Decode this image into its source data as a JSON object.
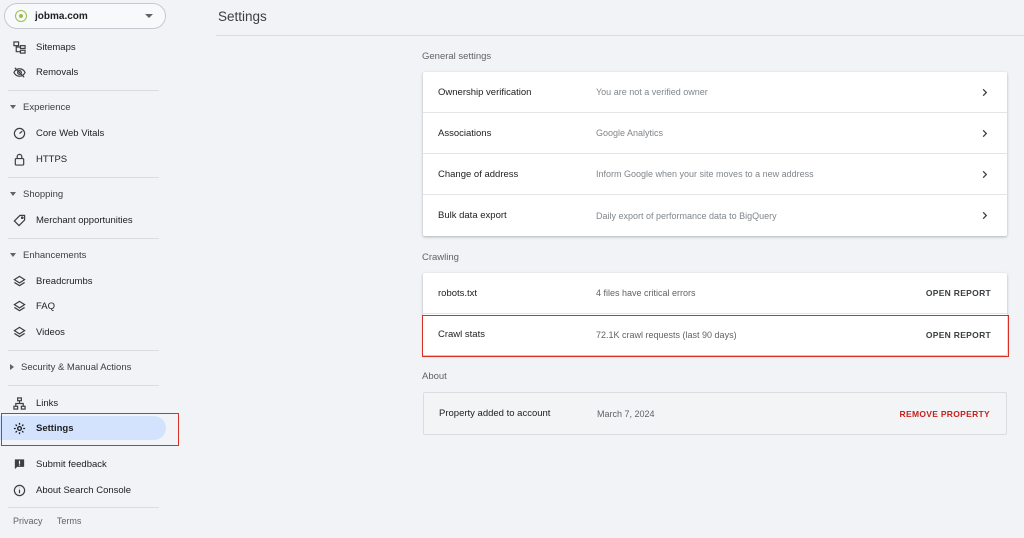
{
  "property": {
    "name": "jobma.com"
  },
  "sidebar": {
    "items_top": [
      {
        "label": "Sitemaps",
        "icon": "sitemap-icon"
      },
      {
        "label": "Removals",
        "icon": "eye-off-icon"
      }
    ],
    "experience": {
      "label": "Experience",
      "items": [
        {
          "label": "Core Web Vitals",
          "icon": "speed-icon"
        },
        {
          "label": "HTTPS",
          "icon": "lock-icon"
        }
      ]
    },
    "shopping": {
      "label": "Shopping",
      "items": [
        {
          "label": "Merchant opportunities",
          "icon": "tag-icon"
        }
      ]
    },
    "enhancements": {
      "label": "Enhancements",
      "items": [
        {
          "label": "Breadcrumbs",
          "icon": "layers-icon"
        },
        {
          "label": "FAQ",
          "icon": "layers-icon"
        },
        {
          "label": "Videos",
          "icon": "layers-icon"
        }
      ]
    },
    "security": {
      "label": "Security & Manual Actions"
    },
    "links": {
      "label": "Links",
      "icon": "links-icon"
    },
    "settings": {
      "label": "Settings",
      "icon": "gear-icon"
    },
    "feedback": {
      "label": "Submit feedback",
      "icon": "feedback-icon"
    },
    "about": {
      "label": "About Search Console",
      "icon": "info-icon"
    },
    "footer": {
      "privacy": "Privacy",
      "terms": "Terms"
    }
  },
  "header": {
    "title": "Settings"
  },
  "general": {
    "label": "General settings",
    "rows": [
      {
        "label": "Ownership verification",
        "desc": "You are not a verified owner"
      },
      {
        "label": "Associations",
        "desc": "Google Analytics"
      },
      {
        "label": "Change of address",
        "desc": "Inform Google when your site moves to a new address"
      },
      {
        "label": "Bulk data export",
        "desc": "Daily export of performance data to BigQuery"
      }
    ]
  },
  "crawling": {
    "label": "Crawling",
    "rows": [
      {
        "label": "robots.txt",
        "desc": "4 files have critical errors",
        "action": "OPEN REPORT"
      },
      {
        "label": "Crawl stats",
        "desc": "72.1K crawl requests (last 90 days)",
        "action": "OPEN REPORT"
      }
    ]
  },
  "about": {
    "label": "About",
    "rows": [
      {
        "label": "Property added to account",
        "desc": "March 7, 2024",
        "action": "REMOVE PROPERTY"
      }
    ]
  },
  "colors": {
    "highlight": "#d93025",
    "active_bg": "#d3e3fd",
    "danger": "#c5221f"
  }
}
